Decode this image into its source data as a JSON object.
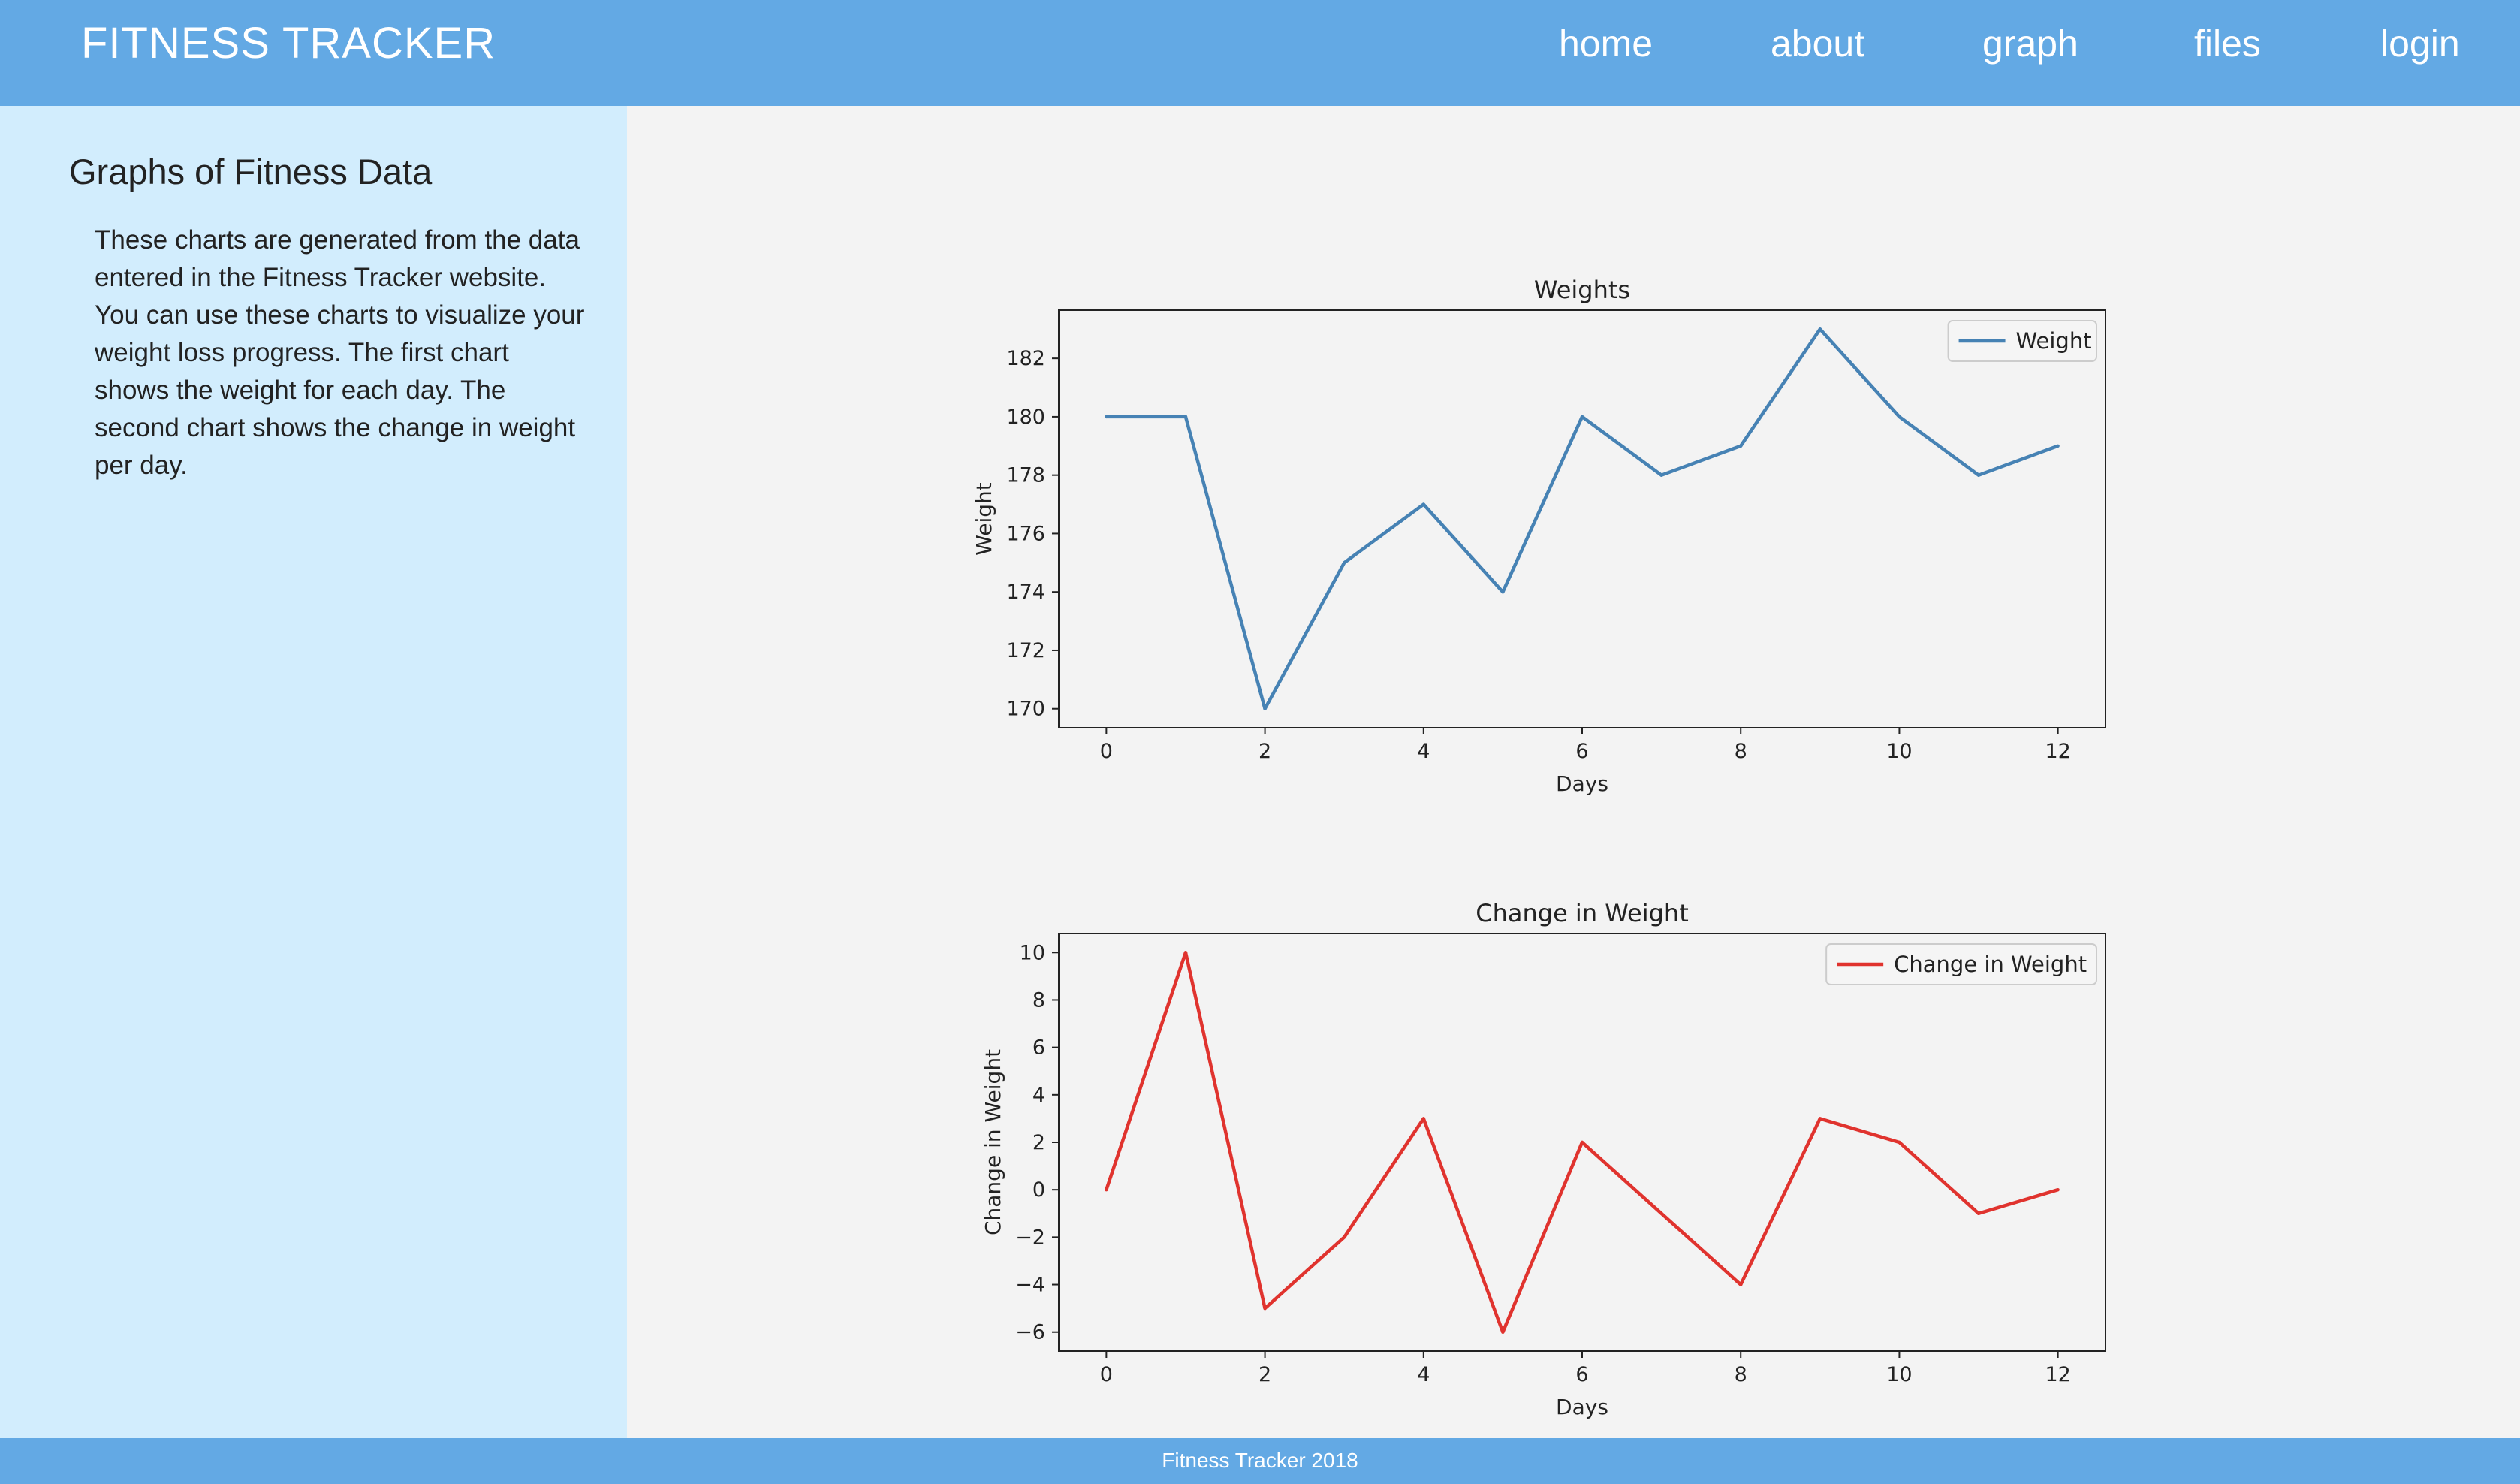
{
  "header": {
    "brand": "FITNESS TRACKER",
    "nav": [
      "home",
      "about",
      "graph",
      "files",
      "login"
    ]
  },
  "sidebar": {
    "title": "Graphs of Fitness Data",
    "description": "These charts are generated from the data entered in the Fitness Tracker website. You can use these charts to visualize your weight loss progress. The first chart shows the weight for each day. The second chart shows the change in weight per day."
  },
  "footer": {
    "text": "Fitness Tracker 2018"
  },
  "colors": {
    "header_bg": "#63a9e4",
    "sidebar_bg": "#d2edfd",
    "main_bg": "#f3f3f3",
    "weight_line": "#4682b4",
    "change_line": "#e0332e"
  },
  "chart_data": [
    {
      "type": "line",
      "title": "Weights",
      "xlabel": "Days",
      "ylabel": "Weight",
      "x": [
        0,
        1,
        2,
        3,
        4,
        5,
        6,
        7,
        8,
        9,
        10,
        11,
        12
      ],
      "series": [
        {
          "name": "Weight",
          "color": "#4682b4",
          "values": [
            180,
            180,
            170,
            175,
            177,
            174,
            180,
            178,
            179,
            183,
            180,
            178,
            179
          ]
        }
      ],
      "xlim": [
        -0.6,
        12.6
      ],
      "ylim": [
        169.35,
        183.65
      ],
      "xticks": [
        0,
        2,
        4,
        6,
        8,
        10,
        12
      ],
      "yticks": [
        170,
        172,
        174,
        176,
        178,
        180,
        182
      ],
      "legend": "upper-right",
      "grid": false
    },
    {
      "type": "line",
      "title": "Change in Weight",
      "xlabel": "Days",
      "ylabel": "Change in Weight",
      "x": [
        0,
        1,
        2,
        3,
        4,
        5,
        6,
        7,
        8,
        9,
        10,
        11,
        12
      ],
      "series": [
        {
          "name": "Change in Weight",
          "color": "#e0332e",
          "values": [
            0,
            10,
            -5,
            -2,
            3,
            -6,
            2,
            -1,
            -4,
            3,
            2,
            -1,
            0
          ]
        }
      ],
      "xlim": [
        -0.6,
        12.6
      ],
      "ylim": [
        -6.8,
        10.8
      ],
      "xticks": [
        0,
        2,
        4,
        6,
        8,
        10,
        12
      ],
      "yticks": [
        -6,
        -4,
        -2,
        0,
        2,
        4,
        6,
        8,
        10
      ],
      "legend": "upper-right",
      "grid": false
    }
  ]
}
